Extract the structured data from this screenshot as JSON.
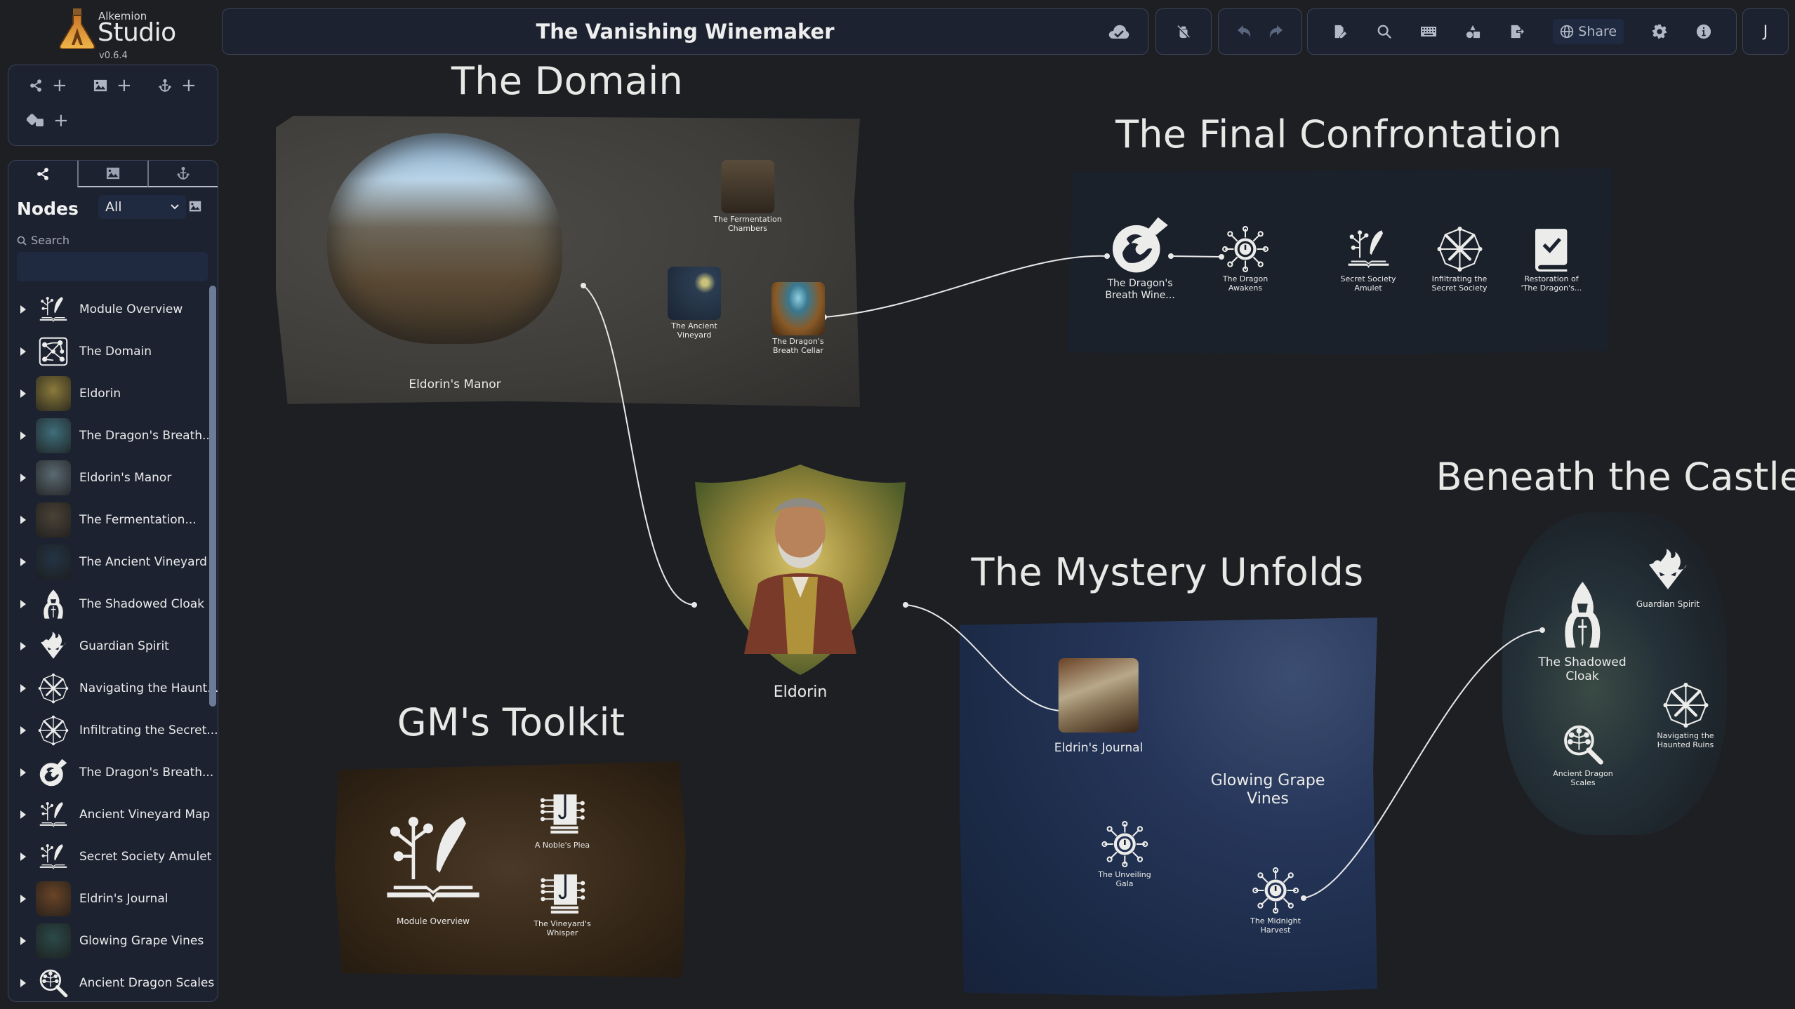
{
  "app": {
    "brand_small": "Alkemion",
    "brand_big": "Studio",
    "version": "v0.6.4"
  },
  "header": {
    "title": "The Vanishing Winemaker",
    "share_label": "Share",
    "user_initial": "J",
    "icons": [
      "cloud-saved-icon",
      "debug-off-icon",
      "undo-icon",
      "redo-icon",
      "edit-document-icon",
      "search-icon",
      "keyboard-icon",
      "shapes-icon",
      "export-icon",
      "globe-icon",
      "settings-icon",
      "info-icon"
    ]
  },
  "sidebar": {
    "actions": [
      {
        "icon": "add-node-icon",
        "label": "+"
      },
      {
        "icon": "add-image-icon",
        "label": "+"
      },
      {
        "icon": "add-anchor-icon",
        "label": "+"
      },
      {
        "icon": "add-dice-icon",
        "label": "+"
      }
    ],
    "tabs": [
      {
        "name": "nodes",
        "icon": "share-nodes-icon",
        "active": true
      },
      {
        "name": "images",
        "icon": "image-icon",
        "active": false
      },
      {
        "name": "anchors",
        "icon": "anchor-icon",
        "active": false
      }
    ],
    "nodes_title": "Nodes",
    "filter_value": "All",
    "search_label": "Search",
    "search_value": "",
    "items": [
      {
        "label": "Module Overview",
        "thumb": "icon-quill-book",
        "bg": ""
      },
      {
        "label": "The Domain",
        "thumb": "icon-domain-graph",
        "bg": ""
      },
      {
        "label": "Eldorin",
        "thumb": "image",
        "bg": "#8a7a3a"
      },
      {
        "label": "The Dragon's Breath...",
        "thumb": "image",
        "bg": "#3f6e7a"
      },
      {
        "label": "Eldorin's Manor",
        "thumb": "image",
        "bg": "#5a6a72"
      },
      {
        "label": "The Fermentation...",
        "thumb": "image",
        "bg": "#4a4236"
      },
      {
        "label": "The Ancient Vineyard",
        "thumb": "image",
        "bg": "#243444"
      },
      {
        "label": "The Shadowed Cloak",
        "thumb": "icon-cloak",
        "bg": ""
      },
      {
        "label": "Guardian Spirit",
        "thumb": "icon-spirit",
        "bg": ""
      },
      {
        "label": "Navigating the Haunt...",
        "thumb": "icon-swords-circle",
        "bg": ""
      },
      {
        "label": "Infiltrating the Secret...",
        "thumb": "icon-swords-circle",
        "bg": ""
      },
      {
        "label": "The Dragon's Breath...",
        "thumb": "icon-potion",
        "bg": ""
      },
      {
        "label": "Ancient Vineyard Map",
        "thumb": "icon-quill-book",
        "bg": ""
      },
      {
        "label": "Secret Society Amulet",
        "thumb": "icon-quill-book",
        "bg": ""
      },
      {
        "label": "Eldrin's Journal",
        "thumb": "image",
        "bg": "#6a4426"
      },
      {
        "label": "Glowing Grape Vines",
        "thumb": "image",
        "bg": "#2c4a48"
      },
      {
        "label": "Ancient Dragon Scales",
        "thumb": "icon-magnifier-tree",
        "bg": ""
      }
    ]
  },
  "canvas": {
    "groups": {
      "domain": {
        "title": "The Domain"
      },
      "final": {
        "title": "The Final Confrontation"
      },
      "beneath": {
        "title": "Beneath the Castle"
      },
      "mystery": {
        "title": "The Mystery Unfolds"
      },
      "toolkit": {
        "title": "GM's Toolkit"
      }
    },
    "nodes": {
      "manor": "Eldorin's Manor",
      "fermentation": "The Fermentation\nChambers",
      "vineyard": "The Ancient\nVineyard",
      "cellar": "The Dragon's\nBreath Cellar",
      "eldorin": "Eldorin",
      "wine": "The Dragon's\nBreath Wine...",
      "awakens": "The Dragon\nAwakens",
      "amulet": "Secret Society\nAmulet",
      "infiltrating": "Infiltrating the\nSecret Society",
      "restoration": "Restoration of\n'The Dragon's...",
      "cloak": "The Shadowed\nCloak",
      "spirit": "Guardian Spirit",
      "scales": "Ancient Dragon\nScales",
      "haunted": "Navigating the\nHaunted Ruins",
      "journal": "Eldrin's Journal",
      "vines": "Glowing Grape\nVines",
      "gala": "The Unveiling\nGala",
      "harvest": "The Midnight\nHarvest",
      "overview": "Module Overview",
      "plea": "A Noble's Plea",
      "whisper": "The Vineyard's\nWhisper"
    }
  }
}
